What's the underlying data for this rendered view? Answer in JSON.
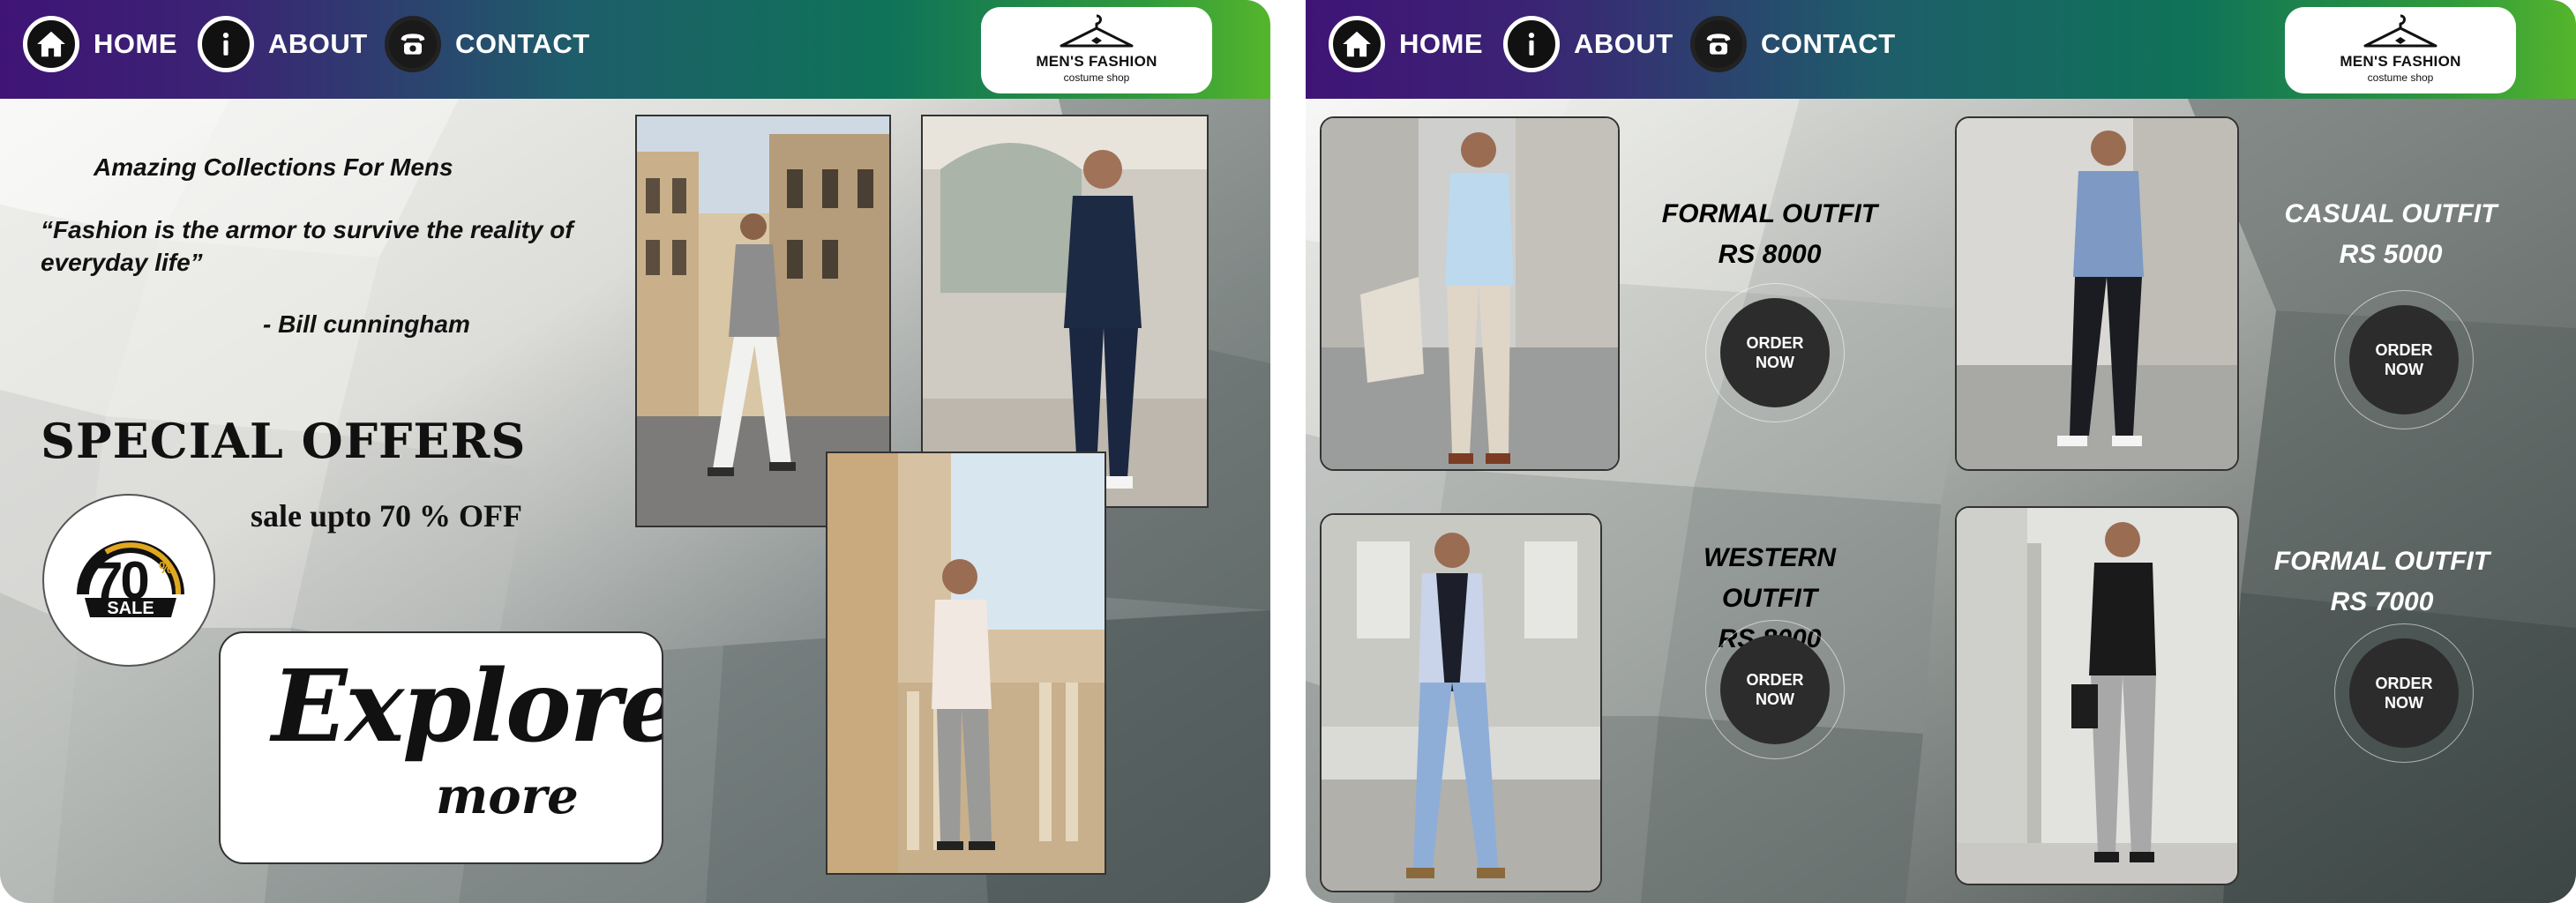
{
  "nav": {
    "home_label": "HOME",
    "about_label": "ABOUT",
    "contact_label": "CONTACT"
  },
  "logo": {
    "title": "MEN'S FASHION",
    "subtitle": "costume shop"
  },
  "hero": {
    "heading": "Amazing Collections For Mens",
    "quote": "“Fashion  is the armor to survive the reality of everyday life”",
    "author": "- Bill cunningham"
  },
  "offers": {
    "title": "SPECIAL OFFERS",
    "sale_text": "sale upto 70 % OFF",
    "badge_number": "70",
    "badge_percent": "%",
    "badge_label": "SALE",
    "explore_line1": "Explore",
    "explore_line2": "more"
  },
  "products": [
    {
      "name": "FORMAL OUTFIT",
      "price": "RS 8000",
      "button": "ORDER NOW"
    },
    {
      "name": "CASUAL OUTFIT",
      "price": "RS 5000",
      "button": "ORDER NOW"
    },
    {
      "name": "WESTERN OUTFIT",
      "price": "RS 8000",
      "button": "ORDER NOW"
    },
    {
      "name": "FORMAL OUTFIT",
      "price": "RS 7000",
      "button": "ORDER NOW"
    }
  ],
  "colors": {
    "nav_start": "#3f1476",
    "nav_mid": "#0f7358",
    "nav_end": "#55b52c",
    "button": "#2c2c2c",
    "badge_gold": "#e0a820"
  },
  "icons": {
    "home": "home-icon",
    "about": "info-icon",
    "contact": "phone-icon",
    "logo": "hanger-icon"
  }
}
